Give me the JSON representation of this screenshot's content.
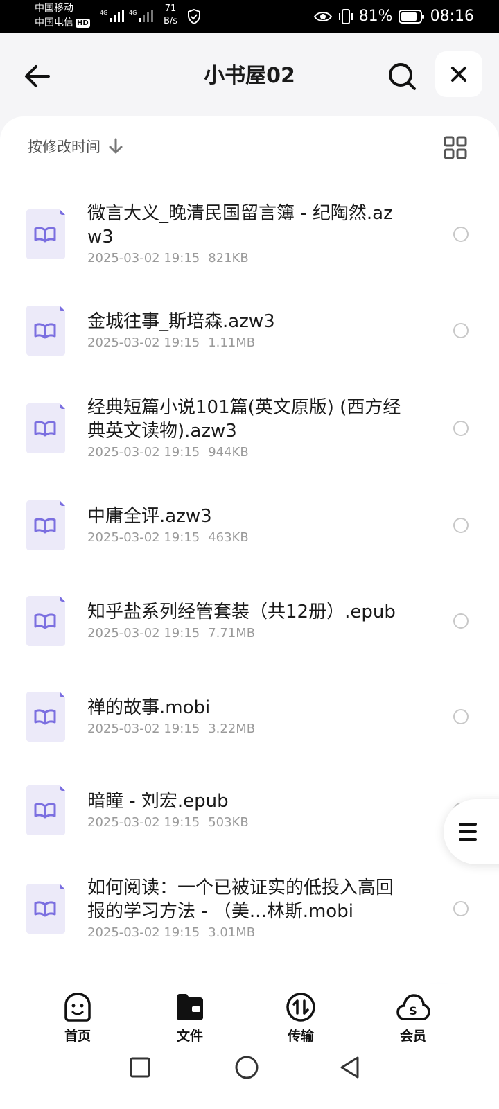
{
  "status_bar": {
    "carrier1": "中国移动",
    "carrier2": "中国电信",
    "hd": "HD",
    "net1": "4G",
    "net2": "4G",
    "speed_value": "71",
    "speed_unit": "B/s",
    "battery": "81%",
    "time": "08:16"
  },
  "header": {
    "title": "小书屋02",
    "back_icon": "arrow-left-icon",
    "search_icon": "search-icon",
    "close_icon": "close-icon"
  },
  "sort": {
    "label": "按修改时间",
    "direction_icon": "arrow-down-icon",
    "view_icon": "grid-view-icon"
  },
  "files": [
    {
      "name": "微言大义_晚清民国留言簿 - 纪陶然.azw3",
      "date": "2025-03-02 19:15",
      "size": "821KB"
    },
    {
      "name": "金城往事_斯培森.azw3",
      "date": "2025-03-02 19:15",
      "size": "1.11MB"
    },
    {
      "name": "经典短篇小说101篇(英文原版) (西方经典英文读物).azw3",
      "date": "2025-03-02 19:15",
      "size": "944KB"
    },
    {
      "name": "中庸全评.azw3",
      "date": "2025-03-02 19:15",
      "size": "463KB"
    },
    {
      "name": "知乎盐系列经管套装（共12册）.epub",
      "date": "2025-03-02 19:15",
      "size": "7.71MB"
    },
    {
      "name": "禅的故事.mobi",
      "date": "2025-03-02 19:15",
      "size": "3.22MB"
    },
    {
      "name": "暗瞳 - 刘宏.epub",
      "date": "2025-03-02 19:15",
      "size": "503KB"
    },
    {
      "name": "如何阅读：一个已被证实的低投入高回报的学习方法 - （美...林斯.mobi",
      "date": "2025-03-02 19:15",
      "size": "3.01MB"
    }
  ],
  "bottom_nav": [
    {
      "label": "首页",
      "icon": "home-face-icon"
    },
    {
      "label": "文件",
      "icon": "folder-icon"
    },
    {
      "label": "传输",
      "icon": "transfer-icon"
    },
    {
      "label": "会员",
      "icon": "vip-cloud-icon"
    }
  ],
  "colors": {
    "accent": "#1a66ff",
    "book_icon_bg": "#eceaf9",
    "book_icon_fg": "#7b6fe0"
  }
}
